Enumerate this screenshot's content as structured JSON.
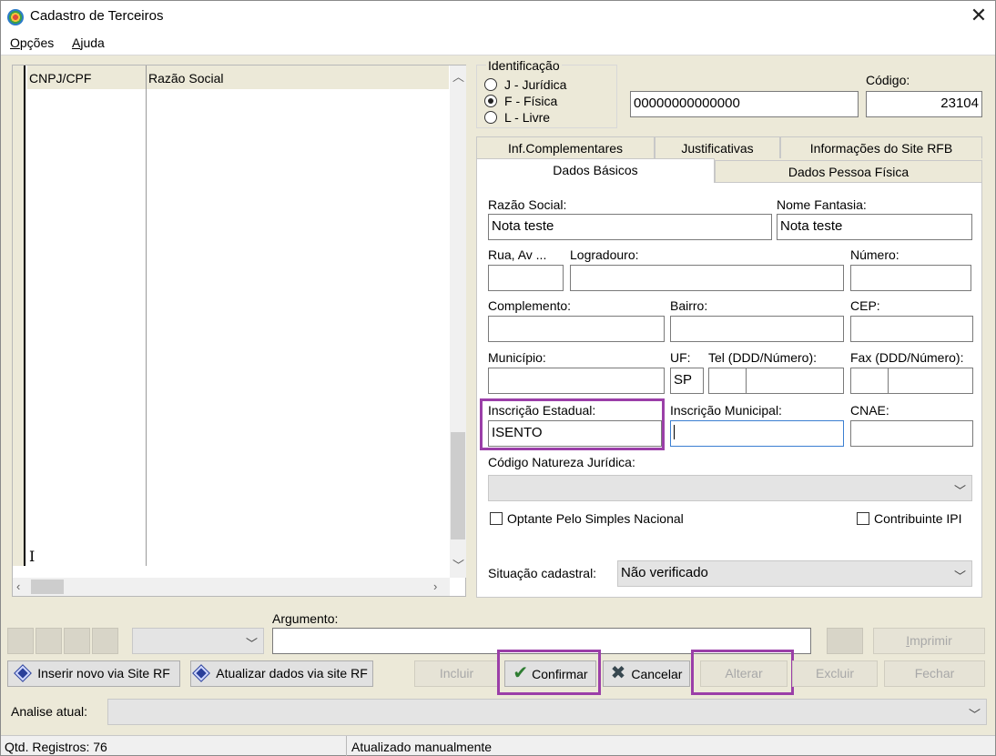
{
  "window": {
    "title": "Cadastro de Terceiros",
    "close_symbol": "✕"
  },
  "menu": {
    "opcoes": "Opções",
    "ajuda": "Ajuda"
  },
  "grid": {
    "col_cnpj": "CNPJ/CPF",
    "col_razao": "Razão Social"
  },
  "identificacao": {
    "title": "Identificação",
    "options": [
      "J - Jurídica",
      "F - Física",
      "L - Livre"
    ],
    "selected": "F - Física",
    "document_value": "00000000000000",
    "codigo_label": "Código:",
    "codigo_value": "23104"
  },
  "tabs": {
    "top": [
      "Inf.Complementares",
      "Justificativas",
      "Informações do Site RFB"
    ],
    "bottom": [
      "Dados Básicos",
      "Dados Pessoa Física"
    ],
    "active": "Dados Básicos"
  },
  "form": {
    "razao_social_label": "Razão Social:",
    "razao_social_value": "Nota teste",
    "nome_fantasia_label": "Nome Fantasia:",
    "nome_fantasia_value": "Nota teste",
    "rua_label": "Rua, Av ...",
    "logradouro_label": "Logradouro:",
    "numero_label": "Número:",
    "complemento_label": "Complemento:",
    "bairro_label": "Bairro:",
    "cep_label": "CEP:",
    "municipio_label": "Município:",
    "uf_label": "UF:",
    "uf_value": "SP",
    "tel_label": "Tel (DDD/Número):",
    "fax_label": "Fax (DDD/Número):",
    "inscricao_estadual_label": "Inscrição Estadual:",
    "inscricao_estadual_value": "ISENTO",
    "inscricao_municipal_label": "Inscrição Municipal:",
    "cnae_label": "CNAE:",
    "natureza_label": "Código Natureza Jurídica:",
    "simples_label": "Optante Pelo Simples Nacional",
    "ipi_label": "Contribuinte IPI",
    "situacao_label": "Situação cadastral:",
    "situacao_value": "Não verificado"
  },
  "bottom": {
    "argumento_label": "Argumento:",
    "imprimir": "Imprimir",
    "inserir_rf": "Inserir novo via Site RF",
    "atualizar_rf": "Atualizar dados via site RF",
    "incluir": "Incluir",
    "confirmar": "Confirmar",
    "cancelar": "Cancelar",
    "alterar": "Alterar",
    "excluir": "Excluir",
    "fechar": "Fechar",
    "analise_label": "Analise atual:"
  },
  "status": {
    "registros": "Qtd. Registros: 76",
    "atualizado": "Atualizado manualmente"
  },
  "colors": {
    "highlight": "#9B3FA8",
    "window_bg": "#ECE9D8",
    "confirm_check": "#2e7d32",
    "cancel_x": "#37474f"
  }
}
